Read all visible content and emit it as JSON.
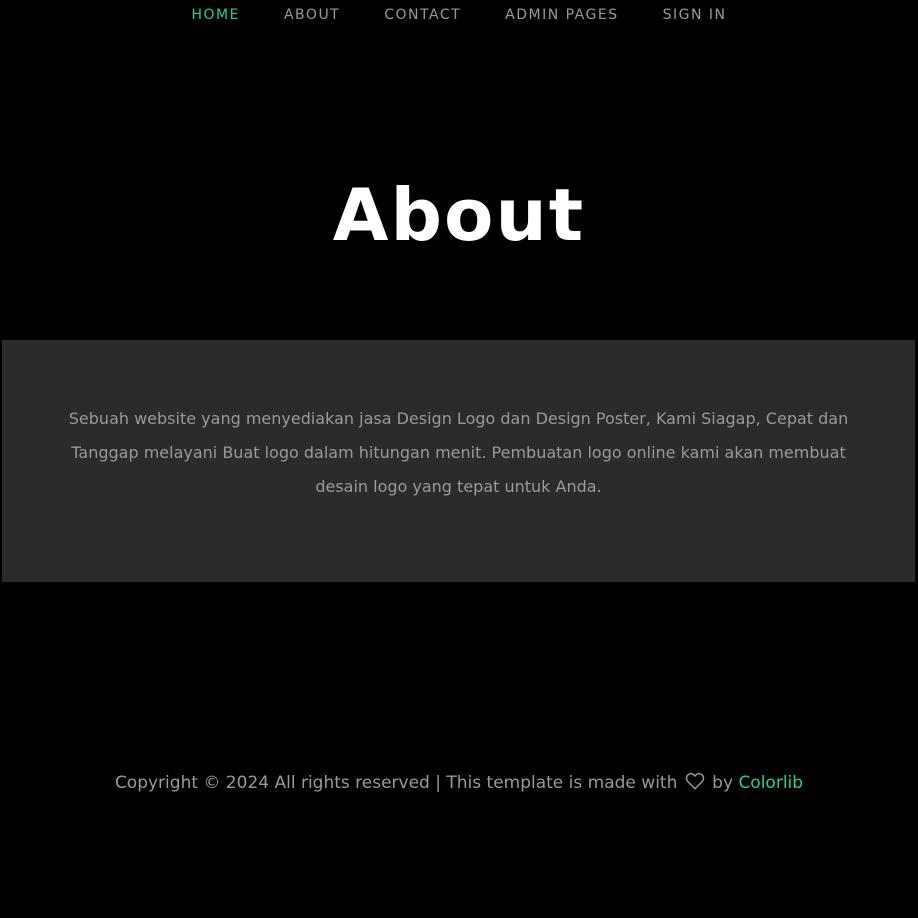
{
  "nav": {
    "items": [
      {
        "label": "HOME",
        "active": true
      },
      {
        "label": "ABOUT",
        "active": false
      },
      {
        "label": "CONTACT",
        "active": false
      },
      {
        "label": "ADMIN PAGES",
        "active": false
      },
      {
        "label": "SIGN IN",
        "active": false
      }
    ]
  },
  "hero": {
    "title": "About"
  },
  "about": {
    "text": "Sebuah website yang menyediakan jasa Design Logo dan Design Poster, Kami Siagap, Cepat dan Tanggap melayani Buat logo dalam hitungan menit. Pembuatan logo online kami akan membuat desain logo yang tepat untuk Anda."
  },
  "footer": {
    "prefix": "Copyright © 2024 All rights reserved | This template is made with",
    "heart_icon": "heart-outline-icon",
    "by": "by",
    "brand": "Colorlib"
  },
  "colors": {
    "background": "#000000",
    "panel": "#2b2b2b",
    "accent": "#2ecc8f",
    "muted_text": "#9a9a9a",
    "title": "#ffffff"
  }
}
